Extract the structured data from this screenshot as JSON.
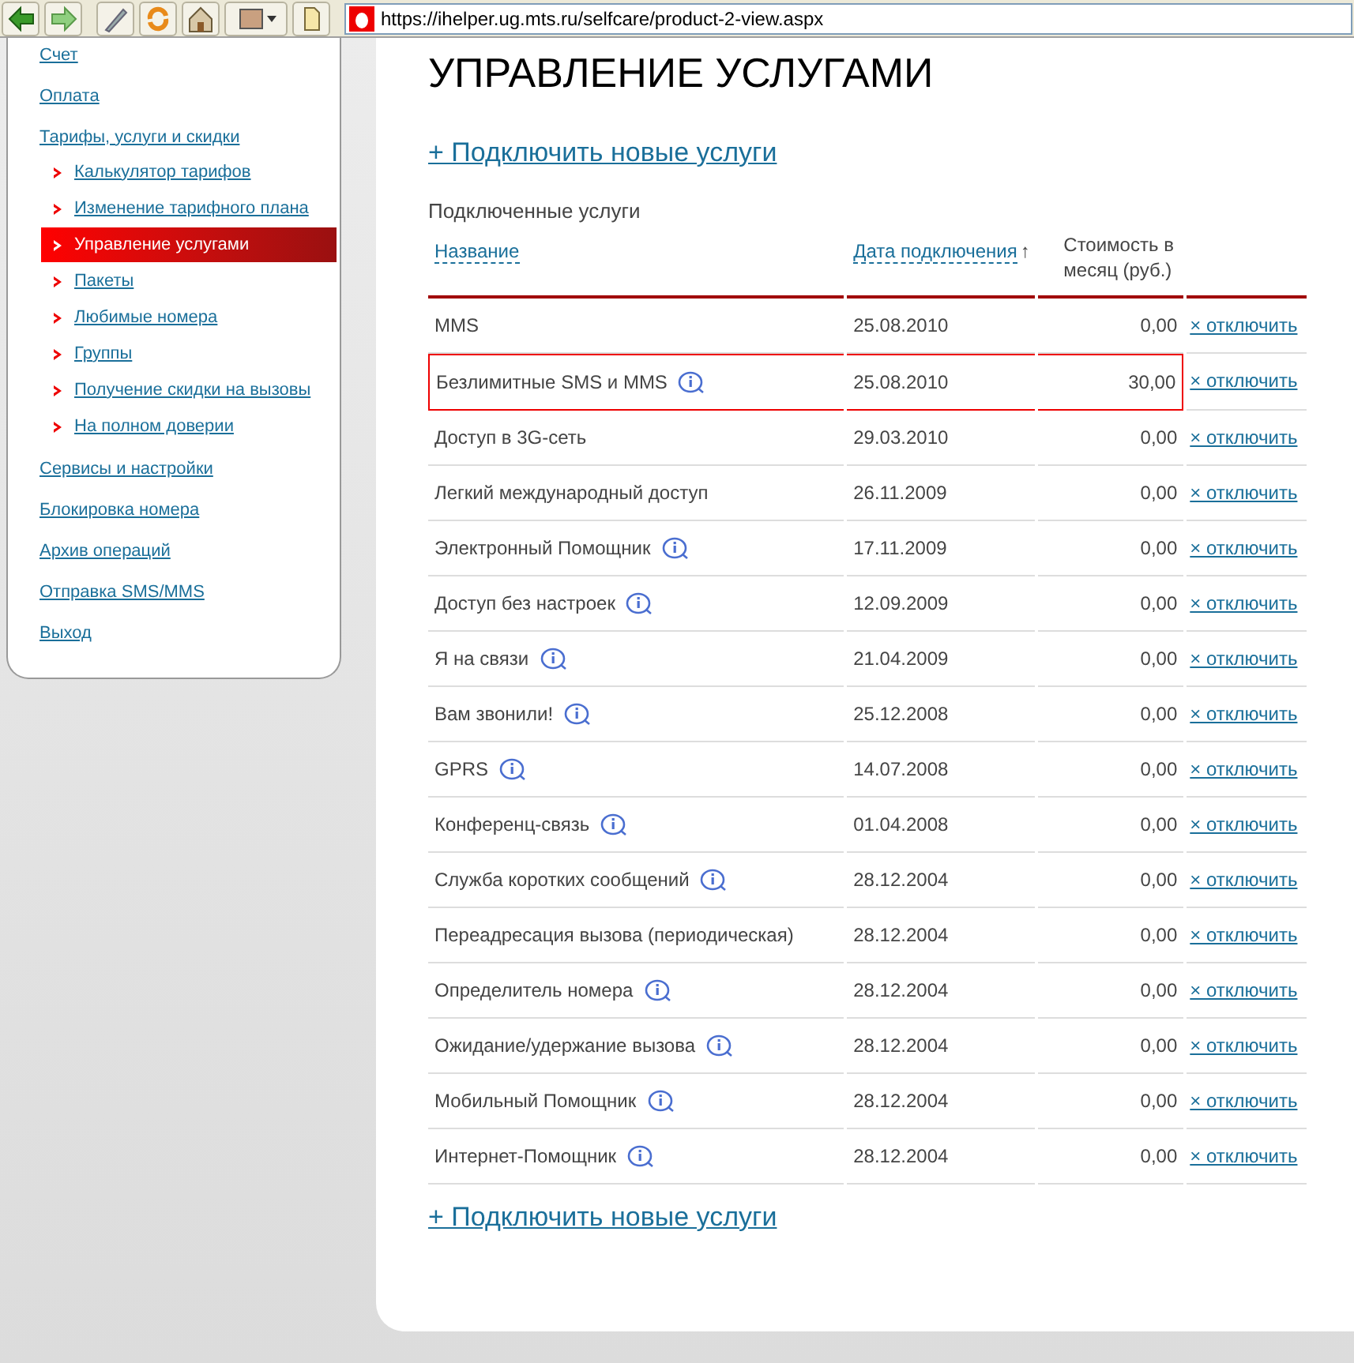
{
  "toolbar": {
    "address": "https://ihelper.ug.mts.ru/selfcare/product-2-view.aspx"
  },
  "sidebar": {
    "items": [
      {
        "label": "Счет",
        "selected": false
      },
      {
        "label": "Оплата",
        "selected": false
      },
      {
        "label": "Тарифы, услуги и скидки",
        "selected": false,
        "children": [
          {
            "label": "Калькулятор тарифов",
            "selected": false
          },
          {
            "label": "Изменение тарифного плана",
            "selected": false
          },
          {
            "label": "Управление услугами",
            "selected": true
          },
          {
            "label": "Пакеты",
            "selected": false
          },
          {
            "label": "Любимые номера",
            "selected": false
          },
          {
            "label": "Группы",
            "selected": false
          },
          {
            "label": "Получение скидки на вызовы",
            "selected": false
          },
          {
            "label": "На полном доверии",
            "selected": false
          }
        ]
      },
      {
        "label": "Сервисы и настройки",
        "selected": false
      },
      {
        "label": "Блокировка номера",
        "selected": false
      },
      {
        "label": "Архив операций",
        "selected": false
      },
      {
        "label": "Отправка SMS/MMS",
        "selected": false
      },
      {
        "label": "Выход",
        "selected": false
      }
    ]
  },
  "title": "УПРАВЛЕНИЕ УСЛУГАМИ",
  "add_link_top": "+ Подключить новые услуги",
  "section_title": "Подключенные услуги",
  "table": {
    "columns": [
      {
        "label": "Название",
        "sortable": true
      },
      {
        "label": "Дата подключения",
        "sortable": true,
        "sort_mark": "↑"
      },
      {
        "label": "Стоимость в месяц (руб.)",
        "sortable": false
      }
    ],
    "rows": [
      {
        "name": "MMS",
        "info": false,
        "date": "25.08.2010",
        "cost": "0,00",
        "action": "× отключить",
        "highlighted": false
      },
      {
        "name": "Безлимитные SMS и MMS",
        "info": true,
        "date": "25.08.2010",
        "cost": "30,00",
        "action": "× отключить",
        "highlighted": true
      },
      {
        "name": "Доступ в 3G-сеть",
        "info": false,
        "date": "29.03.2010",
        "cost": "0,00",
        "action": "× отключить",
        "highlighted": false
      },
      {
        "name": "Легкий международный доступ",
        "info": false,
        "date": "26.11.2009",
        "cost": "0,00",
        "action": "× отключить",
        "highlighted": false
      },
      {
        "name": "Электронный Помощник",
        "info": true,
        "date": "17.11.2009",
        "cost": "0,00",
        "action": "× отключить",
        "highlighted": false
      },
      {
        "name": "Доступ без настроек",
        "info": true,
        "date": "12.09.2009",
        "cost": "0,00",
        "action": "× отключить",
        "highlighted": false
      },
      {
        "name": "Я на связи",
        "info": true,
        "date": "21.04.2009",
        "cost": "0,00",
        "action": "× отключить",
        "highlighted": false
      },
      {
        "name": "Вам звонили!",
        "info": true,
        "date": "25.12.2008",
        "cost": "0,00",
        "action": "× отключить",
        "highlighted": false
      },
      {
        "name": "GPRS",
        "info": true,
        "date": "14.07.2008",
        "cost": "0,00",
        "action": "× отключить",
        "highlighted": false
      },
      {
        "name": "Конференц-связь",
        "info": true,
        "date": "01.04.2008",
        "cost": "0,00",
        "action": "× отключить",
        "highlighted": false
      },
      {
        "name": "Служба коротких сообщений",
        "info": true,
        "date": "28.12.2004",
        "cost": "0,00",
        "action": "× отключить",
        "highlighted": false
      },
      {
        "name": "Переадресация вызова (периодическая)",
        "info": false,
        "date": "28.12.2004",
        "cost": "0,00",
        "action": "× отключить",
        "highlighted": false
      },
      {
        "name": "Определитель номера",
        "info": true,
        "date": "28.12.2004",
        "cost": "0,00",
        "action": "× отключить",
        "highlighted": false
      },
      {
        "name": "Ожидание/удержание вызова",
        "info": true,
        "date": "28.12.2004",
        "cost": "0,00",
        "action": "× отключить",
        "highlighted": false
      },
      {
        "name": "Мобильный Помощник",
        "info": true,
        "date": "28.12.2004",
        "cost": "0,00",
        "action": "× отключить",
        "highlighted": false
      },
      {
        "name": "Интернет-Помощник",
        "info": true,
        "date": "28.12.2004",
        "cost": "0,00",
        "action": "× отключить",
        "highlighted": false
      }
    ]
  },
  "add_link_bottom": "+ Подключить новые услуги"
}
